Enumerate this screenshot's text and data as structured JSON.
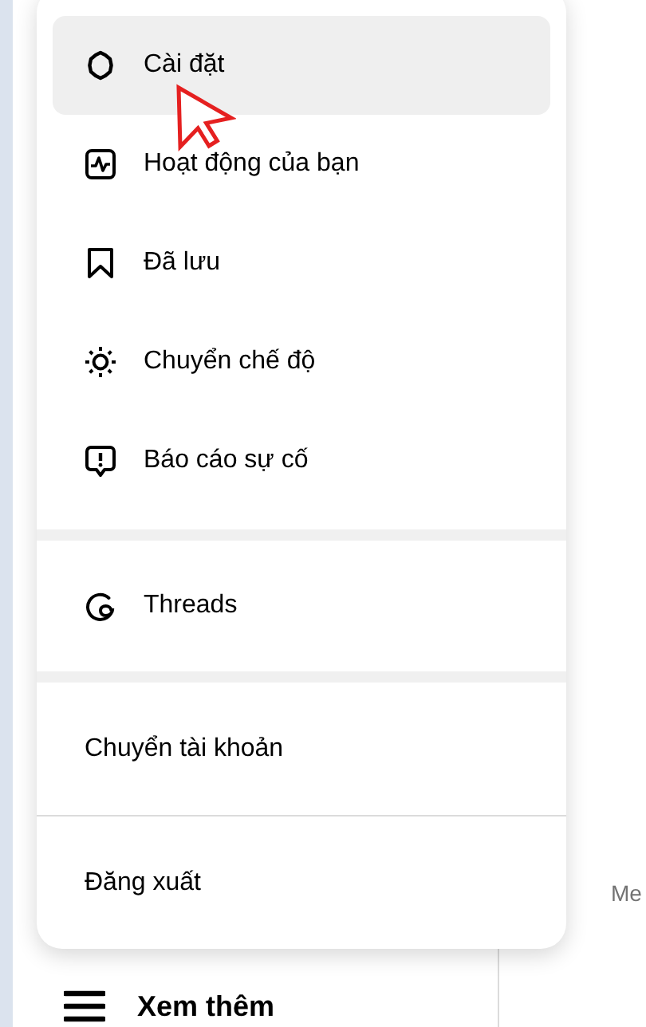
{
  "menu": {
    "sections": [
      {
        "items": [
          {
            "kind": "settings",
            "label": "Cài đặt",
            "selected": true
          },
          {
            "kind": "activity",
            "label": "Hoạt động của bạn",
            "selected": false
          },
          {
            "kind": "saved",
            "label": "Đã lưu",
            "selected": false
          },
          {
            "kind": "appearance",
            "label": "Chuyển chế độ",
            "selected": false
          },
          {
            "kind": "report",
            "label": "Báo cáo sự cố",
            "selected": false
          }
        ]
      },
      {
        "items": [
          {
            "kind": "threads",
            "label": "Threads",
            "selected": false
          }
        ]
      },
      {
        "items": [
          {
            "kind": "plain",
            "label": "Chuyển tài khoản",
            "selected": false
          },
          {
            "kind": "plain",
            "label": "Đăng xuất",
            "selected": false
          }
        ]
      }
    ]
  },
  "sidebar": {
    "more_label": "Xem thêm"
  },
  "main": {
    "text_fragment": "Me"
  }
}
